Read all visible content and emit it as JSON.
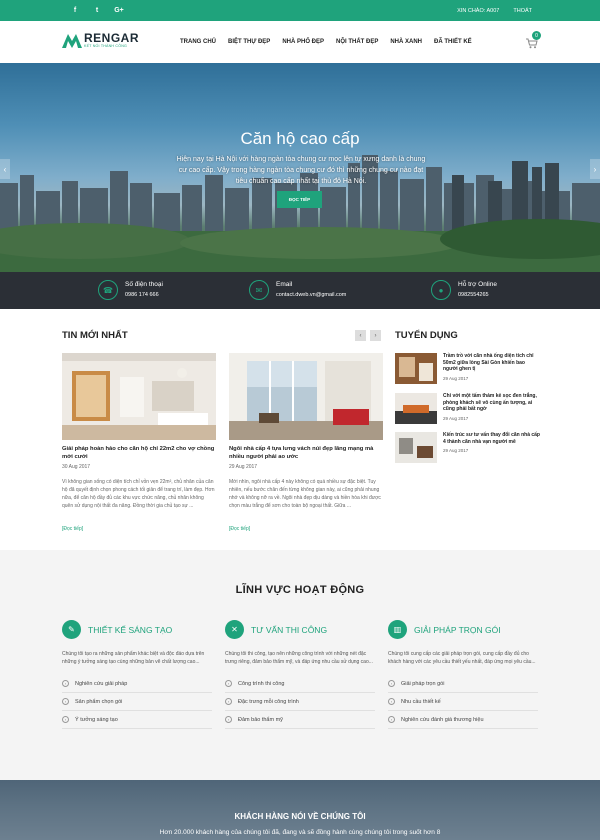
{
  "topbar": {
    "social": [
      "f",
      "t",
      "G+"
    ],
    "greeting": "XIN CHÀO: A007",
    "logout": "THOÁT"
  },
  "logo": {
    "name": "RENGAR",
    "tagline": "KẾT NỐI THÀNH CÔNG"
  },
  "nav": [
    "TRANG CHỦ",
    "BIỆT THỰ ĐẸP",
    "NHÀ PHỐ ĐẸP",
    "NỘI THẤT ĐẸP",
    "NHÀ XANH",
    "ĐÃ THIẾT KẾ"
  ],
  "cart": {
    "count": "0",
    "icon": "cart-icon"
  },
  "hero": {
    "title": "Căn hộ cao cấp",
    "text": "Hiện nay tại Hà Nội với hàng ngàn tòa chung cư mọc lên tự xưng danh là chung cư cao cấp. Vậy trong hàng ngàn tòa chung cư đó thì những chung cư nào đạt tiêu chuẩn cao cấp nhất tại thủ đô Hà Nội.",
    "button": "ĐỌC TIẾP",
    "prev": "‹",
    "next": "›"
  },
  "contacts": [
    {
      "icon": "phone-icon",
      "title": "Số điện thoại",
      "value": "0986 174 666"
    },
    {
      "icon": "email-icon",
      "title": "Email",
      "value": "contact.dweb.vn@gmail.com"
    },
    {
      "icon": "chat-icon",
      "title": "Hỗ trợ Online",
      "value": "0982554265"
    }
  ],
  "news": {
    "heading": "TIN MỚI NHẤT",
    "prev": "‹",
    "next": "›",
    "items": [
      {
        "title": "Giải pháp hoàn hảo cho căn hộ chỉ 22m2 cho vợ chồng mới cưới",
        "date": "30 Aug 2017",
        "excerpt": "Vì không gian sống có diện tích chỉ vỏn vẹn 22m², chủ nhân của căn hộ đã quyết định chọn phong cách tối giản để trang trí, làm đẹp. Hơn nữa, để căn hộ đầy đủ các khu vực chức năng, chủ nhân không quên sử dụng nội thất đa năng. Đồng thời gia chủ tạo sự ...",
        "more": "[Đọc tiếp]"
      },
      {
        "title": "Ngôi nhà cấp 4 tựa lưng vách núi đẹp lãng mạng mà nhiều người phải ao ước",
        "date": "29 Aug 2017",
        "excerpt": "Mới nhìn, ngôi nhà cấp 4 này không có quá nhiều sự đặc biệt. Tuy nhiên, nếu bước chân đến từng không gian này, ai cũng phải nhung nhớ và không nỡ ra về. Ngôi nhà đẹp dịu dàng và hiền hòa khi được chọn màu trắng để sơn cho toàn bộ ngoại thất. Giữa ...",
        "more": "[Đọc tiếp]"
      }
    ]
  },
  "jobs": {
    "heading": "TUYỂN DỤNG",
    "items": [
      {
        "title": "Trầm trồ với căn nhà ống diện tích chỉ 50m2 giữa lòng Sài Gòn khiến bao người ghen tị",
        "date": "29 Aug 2017"
      },
      {
        "title": "Chỉ với một tấm thảm kẻ sọc đen trắng, phòng khách sẽ vô cùng ấn tượng, ai cũng phải bất ngờ",
        "date": "29 Aug 2017"
      },
      {
        "title": "Kiến trúc sư tư vấn thay đổi căn nhà cấp 4 thành căn nhà vạn người mê",
        "date": "29 Aug 2017"
      }
    ]
  },
  "areas": {
    "heading": "LĨNH VỰC HOẠT ĐỘNG",
    "columns": [
      {
        "icon": "design-icon",
        "title": "THIẾT KẾ SÁNG TẠO",
        "desc": "Chúng tôi tạo ra những sản phẩm khác biệt và độc đáo dựa trên những ý tưởng sáng tạo cùng những bản vẽ chất lượng cao...",
        "items": [
          "Nghiên cứu giải pháp",
          "Sản phẩm chọn gói",
          "Ý tưởng sáng tạo"
        ]
      },
      {
        "icon": "tools-icon",
        "title": "TƯ VẤN THI CÔNG",
        "desc": "Chúng tôi thi công, tạo nên những công trình với những nét đặc trưng riêng, đảm bảo thẩm mỹ, và đáp ứng nhu cầu sử dụng cao...",
        "items": [
          "Công trình thi công",
          "Đặc trưng mỗi công trình",
          "Đảm bảo thẩm mỹ"
        ]
      },
      {
        "icon": "building-icon",
        "title": "GIẢI PHÁP TRỌN GÓI",
        "desc": "Chúng tôi cung cấp các giải pháp trọn gói, cung cấp đầy đủ cho khách hàng với các yêu cầu thiết yếu nhất, đáp ứng mọi yêu cầu...",
        "items": [
          "Giải pháp trọn gói",
          "Nhu cầu thiết kế",
          "Nghiên cứu đánh giá thương hiệu"
        ]
      }
    ]
  },
  "testimonials": {
    "heading": "KHÁCH HÀNG NÓI VỀ CHÚNG TÔI",
    "text": "Hơn 20.000 khách hàng của chúng tôi đã, đang và sẽ đồng hành cùng chúng tôi trong suốt hơn 8"
  },
  "colors": {
    "accent": "#1fa37c",
    "dark": "#2b2f36"
  }
}
